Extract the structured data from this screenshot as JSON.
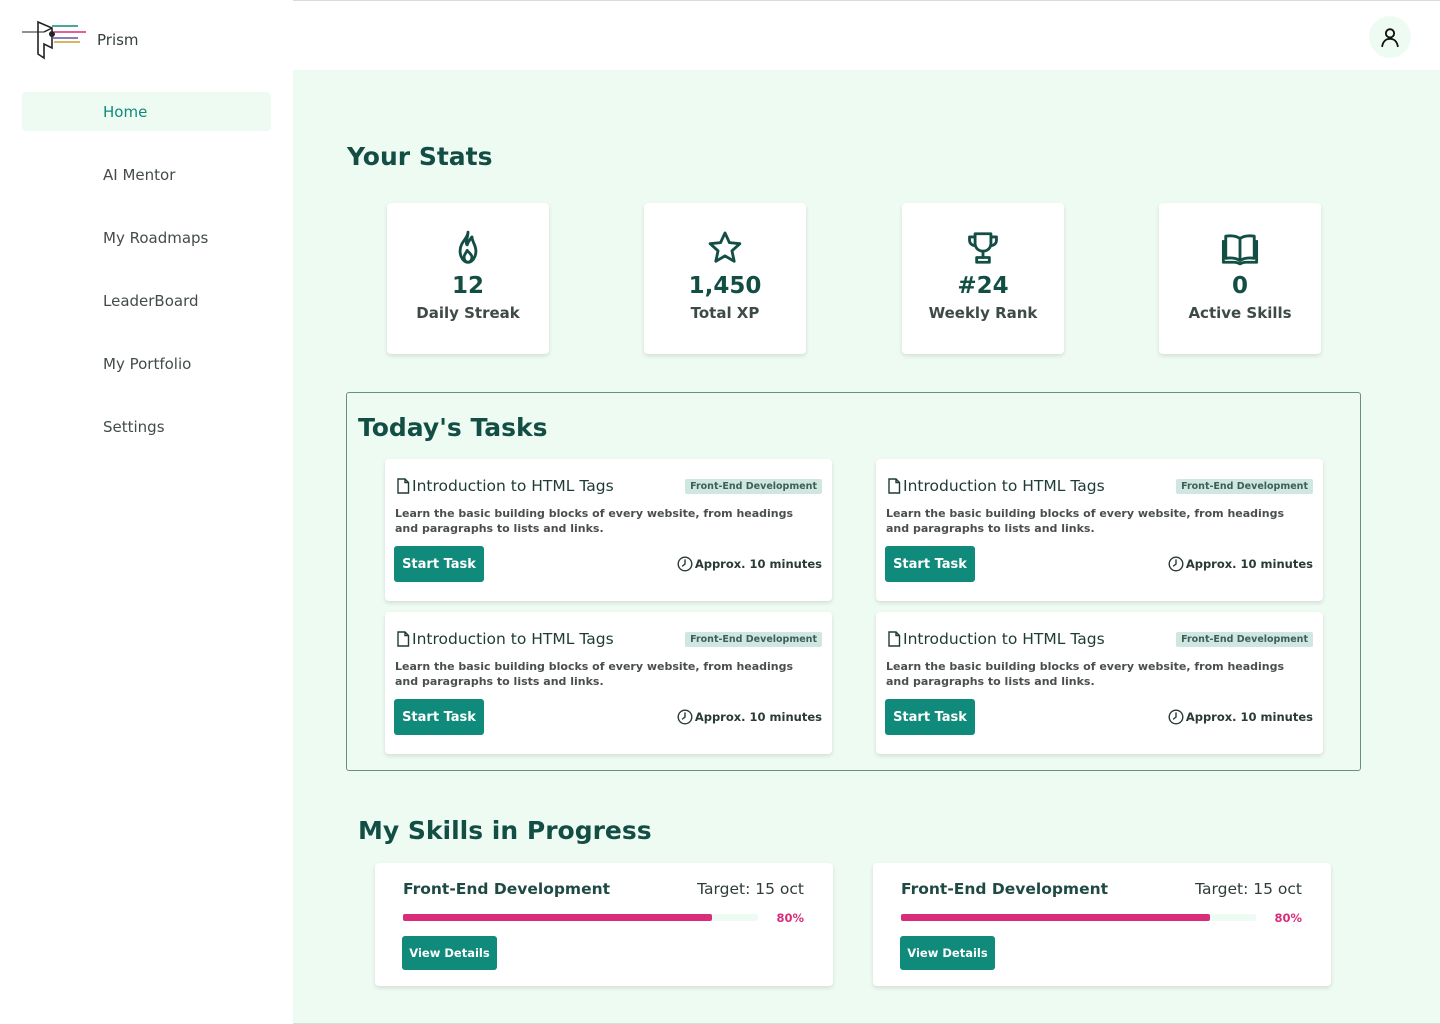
{
  "app": {
    "name": "Prism"
  },
  "sidebar": {
    "items": [
      {
        "label": "Home",
        "active": true
      },
      {
        "label": "AI Mentor"
      },
      {
        "label": "My Roadmaps"
      },
      {
        "label": "LeaderBoard"
      },
      {
        "label": "My Portfolio"
      },
      {
        "label": "Settings"
      }
    ]
  },
  "header": {
    "avatar_icon": "user-icon"
  },
  "stats": {
    "title": "Your Stats",
    "cards": [
      {
        "icon": "flame-icon",
        "value": "12",
        "label": "Daily Streak"
      },
      {
        "icon": "star-icon",
        "value": "1,450",
        "label": "Total XP"
      },
      {
        "icon": "trophy-icon",
        "value": "#24",
        "label": "Weekly Rank"
      },
      {
        "icon": "book-icon",
        "value": "0",
        "label": "Active Skills"
      }
    ]
  },
  "tasks": {
    "title": "Today's Tasks",
    "items": [
      {
        "title": "Introduction to HTML Tags",
        "tag": "Front-End Development",
        "description": "Learn the basic building blocks of every website, from headings and paragraphs to lists and links.",
        "button": "Start Task",
        "time": "Approx. 10 minutes"
      },
      {
        "title": "Introduction to HTML Tags",
        "tag": "Front-End Development",
        "description": "Learn the basic building blocks of every website, from headings and paragraphs to lists and links.",
        "button": "Start Task",
        "time": "Approx. 10 minutes"
      },
      {
        "title": "Introduction to HTML Tags",
        "tag": "Front-End Development",
        "description": "Learn the basic building blocks of every website, from headings and paragraphs to lists and links.",
        "button": "Start Task",
        "time": "Approx. 10 minutes"
      },
      {
        "title": "Introduction to HTML Tags",
        "tag": "Front-End Development",
        "description": "Learn the basic building blocks of every website, from headings and paragraphs to lists and links.",
        "button": "Start Task",
        "time": "Approx. 10 minutes"
      }
    ]
  },
  "skills": {
    "title": "My Skills in Progress",
    "items": [
      {
        "name": "Front-End Development",
        "target": "Target: 15 oct",
        "progress": 0.87,
        "percent_label": "80%",
        "button": "View Details"
      },
      {
        "name": "Front-End Development",
        "target": "Target: 15 oct",
        "progress": 0.87,
        "percent_label": "80%",
        "button": "View Details"
      }
    ]
  },
  "colors": {
    "accent": "#0f8a7b",
    "heading": "#134e45",
    "panel_bg": "#eefbf3",
    "progress": "#d92d7a",
    "tag_bg": "#cfe7e0"
  }
}
